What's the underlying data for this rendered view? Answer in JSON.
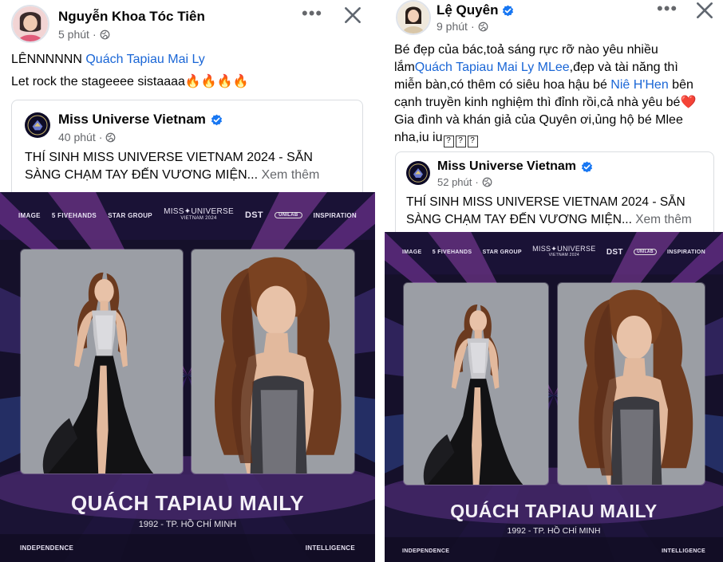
{
  "post_left": {
    "author": "Nguyễn Khoa Tóc Tiên",
    "time": "5 phút",
    "line1_prefix": "LÊNNNNNN ",
    "line1_mention": "Quách Tapiau Mai Ly",
    "line2": "Let rock the stageeee sistaaaa🔥🔥🔥🔥",
    "shared": {
      "page": "Miss Universe Vietnam",
      "time": "40 phút",
      "text_line1": "THÍ SINH MISS UNIVERSE VIETNAM 2024 - SẴN",
      "text_line2": "SÀNG CHẠM TAY ĐẾN VƯƠNG MIỆN...",
      "see_more": "Xem thêm"
    }
  },
  "post_right": {
    "author": "Lệ Quyên",
    "time": "9 phút",
    "line1": "Bé đẹp của bác,toả sáng rực rỡ nào yêu nhiều",
    "line2_prefix": "lắm",
    "line2_mention": "Quách Tapiau Mai Ly MLee",
    "line2_suffix": ",đẹp và tài năng thì",
    "line3_prefix": "miễn bàn,có thêm có siêu hoa hậu bé ",
    "line3_mention": "Niê H'Hen",
    "line3_suffix": " bên",
    "line4": "cạnh truyền kinh nghiệm thì đỉnh rồi,cả nhà yêu bé❤️",
    "line5": "Gia đình và khán giả của Quyên ơi,ủng hộ bé Mlee",
    "line6": "nha,iu iu",
    "unknown_glyph": "?",
    "shared": {
      "page": "Miss Universe Vietnam",
      "time": "52 phút",
      "text_line1": "THÍ SINH MISS UNIVERSE VIETNAM 2024 - SẴN",
      "text_line2": "SÀNG CHẠM TAY ĐẾN VƯƠNG MIỆN...",
      "see_more": "Xem thêm"
    }
  },
  "poster": {
    "top_left": "IMAGE",
    "sponsor_1": "5 FIVEHANDS",
    "sponsor_2": "STAR GROUP",
    "brand_title": "MISS✦UNIVERSE",
    "brand_sub": "VIETNAM 2024",
    "sponsor_3": "DST",
    "sponsor_4": "UNILAB",
    "top_right": "INSPIRATION",
    "candidate_name": "QUÁCH TAPIAU MAILY",
    "candidate_info": "1992 - TP. HỒ CHÍ MINH",
    "bottom_left": "INDEPENDENCE",
    "bottom_right": "INTELLIGENCE"
  },
  "icons": {
    "more": "more-horizontal-icon",
    "close": "close-icon",
    "globe": "public-globe-icon",
    "verified": "verified-badge-icon"
  },
  "colors": {
    "link": "#1a66d6",
    "verified": "#1877f2",
    "meta_gray": "#65676b",
    "poster_bg": "#1c1530"
  }
}
